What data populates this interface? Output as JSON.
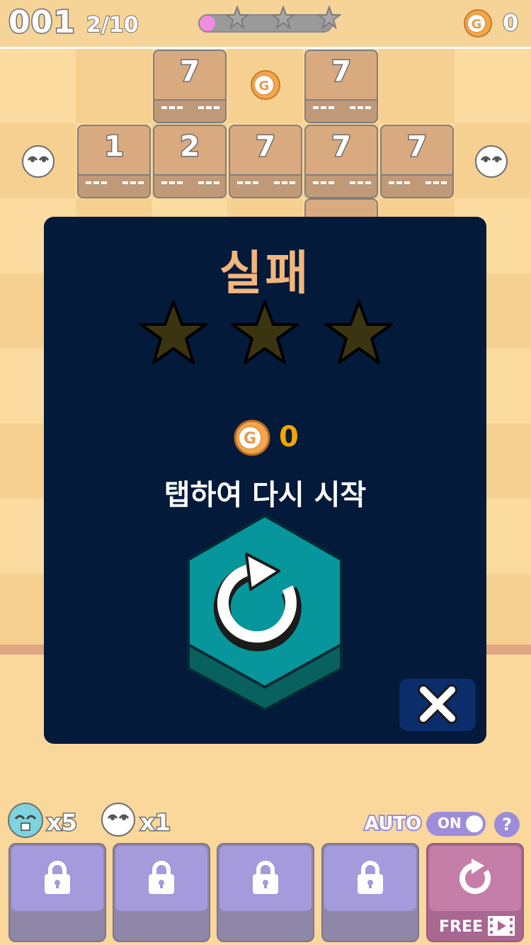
{
  "hud": {
    "level": "001",
    "moves": "2/10",
    "star_progress": 0.12,
    "gold": "0"
  },
  "board": {
    "tiles": [
      {
        "row": 0,
        "col": 2,
        "value": "7"
      },
      {
        "row": 0,
        "col": 4,
        "value": "7"
      },
      {
        "row": 1,
        "col": 1,
        "value": "1"
      },
      {
        "row": 1,
        "col": 2,
        "value": "2"
      },
      {
        "row": 1,
        "col": 3,
        "value": "7"
      },
      {
        "row": 1,
        "col": 4,
        "value": "7"
      },
      {
        "row": 1,
        "col": 5,
        "value": "7"
      }
    ],
    "coin_label": "G"
  },
  "result_modal": {
    "title": "실패",
    "stars_earned": 0,
    "stars_total": 3,
    "reward_gold": "0",
    "tap_hint": "탭하여 다시 시작"
  },
  "bottom": {
    "inventory": [
      {
        "icon": "blue-blob-icon",
        "count": "x5"
      },
      {
        "icon": "white-blob-icon",
        "count": "x1"
      }
    ],
    "auto_label": "AUTO",
    "auto_state": "ON",
    "help_label": "?",
    "free_label": "FREE",
    "locked_slots": 4
  },
  "colors": {
    "modal_bg": "#031a3b",
    "title": "#f3b67c",
    "retry_button": "#07969c",
    "gold": "#f5a400"
  }
}
